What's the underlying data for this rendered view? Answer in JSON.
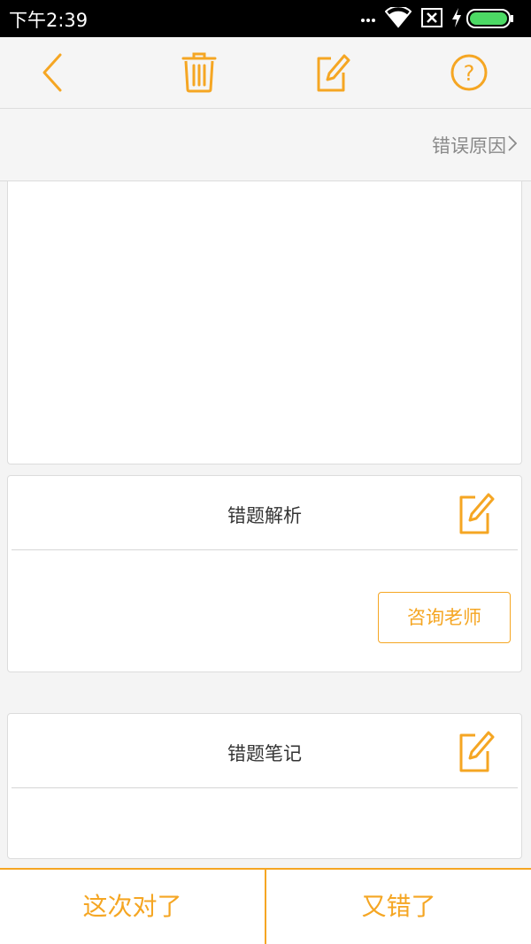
{
  "status_bar": {
    "time": "下午2:39",
    "icons": [
      "signal-dots-icon",
      "wifi-icon",
      "sim-x-icon",
      "charging-icon",
      "battery-icon"
    ]
  },
  "toolbar": {
    "buttons": [
      "back-icon",
      "trash-icon",
      "edit-icon",
      "help-icon"
    ],
    "help_glyph": "?"
  },
  "reason": {
    "label": "错误原因"
  },
  "analysis": {
    "title": "错题解析",
    "consult_label": "咨询老师"
  },
  "notes": {
    "title": "错题笔记"
  },
  "bottom_bar": {
    "correct_label": "这次对了",
    "wrong_label": "又错了"
  },
  "colors": {
    "accent": "#f5a623",
    "background": "#f4f4f4",
    "card": "#ffffff",
    "muted_text": "#8a8a8a"
  }
}
